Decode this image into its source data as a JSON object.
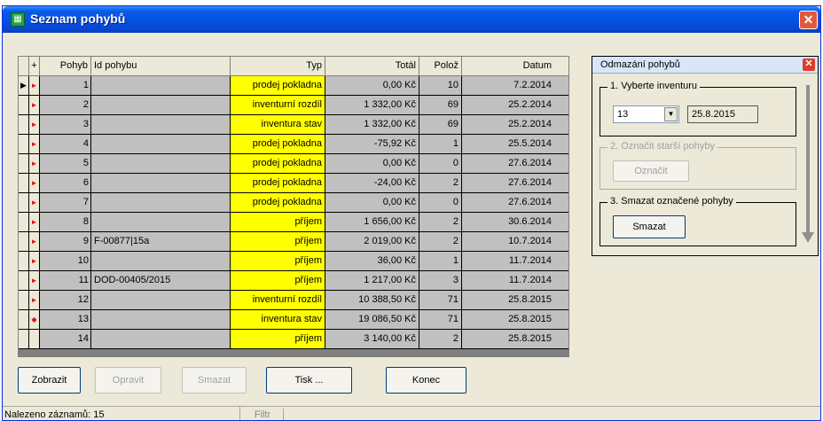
{
  "window": {
    "title": "Seznam pohybů",
    "close_label": "✕"
  },
  "grid": {
    "columns": [
      "+",
      "Pohyb",
      "Id pohybu",
      "Typ",
      "Totál",
      "Polož",
      "Datum"
    ],
    "rows": [
      {
        "pohyb": "1",
        "id": "",
        "typ": "prodej pokladna",
        "total": "0,00 Kč",
        "poloz": "10",
        "datum": "7.2.2014",
        "marker": "current"
      },
      {
        "pohyb": "2",
        "id": "",
        "typ": "inventurní rozdíl",
        "total": "1 332,00 Kč",
        "poloz": "69",
        "datum": "25.2.2014",
        "marker": "arrow"
      },
      {
        "pohyb": "3",
        "id": "",
        "typ": "inventura stav",
        "total": "1 332,00 Kč",
        "poloz": "69",
        "datum": "25.2.2014",
        "marker": "arrow"
      },
      {
        "pohyb": "4",
        "id": "",
        "typ": "prodej pokladna",
        "total": "-75,92 Kč",
        "poloz": "1",
        "datum": "25.5.2014",
        "marker": "arrow"
      },
      {
        "pohyb": "5",
        "id": "",
        "typ": "prodej pokladna",
        "total": "0,00 Kč",
        "poloz": "0",
        "datum": "27.6.2014",
        "marker": "arrow"
      },
      {
        "pohyb": "6",
        "id": "",
        "typ": "prodej pokladna",
        "total": "-24,00 Kč",
        "poloz": "2",
        "datum": "27.6.2014",
        "marker": "arrow"
      },
      {
        "pohyb": "7",
        "id": "",
        "typ": "prodej pokladna",
        "total": "0,00 Kč",
        "poloz": "0",
        "datum": "27.6.2014",
        "marker": "arrow"
      },
      {
        "pohyb": "8",
        "id": "",
        "typ": "příjem",
        "total": "1 656,00 Kč",
        "poloz": "2",
        "datum": "30.6.2014",
        "marker": "arrow"
      },
      {
        "pohyb": "9",
        "id": "F-00877|15a",
        "typ": "příjem",
        "total": "2 019,00 Kč",
        "poloz": "2",
        "datum": "10.7.2014",
        "marker": "arrow"
      },
      {
        "pohyb": "10",
        "id": "",
        "typ": "příjem",
        "total": "36,00 Kč",
        "poloz": "1",
        "datum": "11.7.2014",
        "marker": "arrow"
      },
      {
        "pohyb": "11",
        "id": "DOD-00405/2015",
        "typ": "příjem",
        "total": "1 217,00 Kč",
        "poloz": "3",
        "datum": "11.7.2014",
        "marker": "arrow"
      },
      {
        "pohyb": "12",
        "id": "",
        "typ": "inventurní rozdíl",
        "total": "10 388,50 Kč",
        "poloz": "71",
        "datum": "25.8.2015",
        "marker": "arrow"
      },
      {
        "pohyb": "13",
        "id": "",
        "typ": "inventura stav",
        "total": "19 086,50 Kč",
        "poloz": "71",
        "datum": "25.8.2015",
        "marker": "diamond"
      },
      {
        "pohyb": "14",
        "id": "",
        "typ": "příjem",
        "total": "3 140,00 Kč",
        "poloz": "2",
        "datum": "25.8.2015",
        "marker": "none"
      }
    ]
  },
  "buttons": {
    "zobrazit": "Zobrazit",
    "opravit": "Opravit",
    "smazat": "Smazat",
    "tisk": "Tisk ...",
    "konec": "Konec"
  },
  "panel": {
    "title": "Odmazání pohybů",
    "step1_legend": "1. Vyberte inventuru",
    "inventura_value": "13",
    "inventura_date": "25.8.2015",
    "step2_legend": "2. Označit starší pohyby",
    "oznacit_label": "Označit",
    "step3_legend": "3. Smazat označené pohyby",
    "smazat_label": "Smazat"
  },
  "status": {
    "text": "Nalezeno záznamů: 15",
    "filtr": "Filtr"
  },
  "colors": {
    "type_highlight": "#ffff00",
    "row_bg": "#c0c0c0",
    "marker": "#e01010"
  }
}
